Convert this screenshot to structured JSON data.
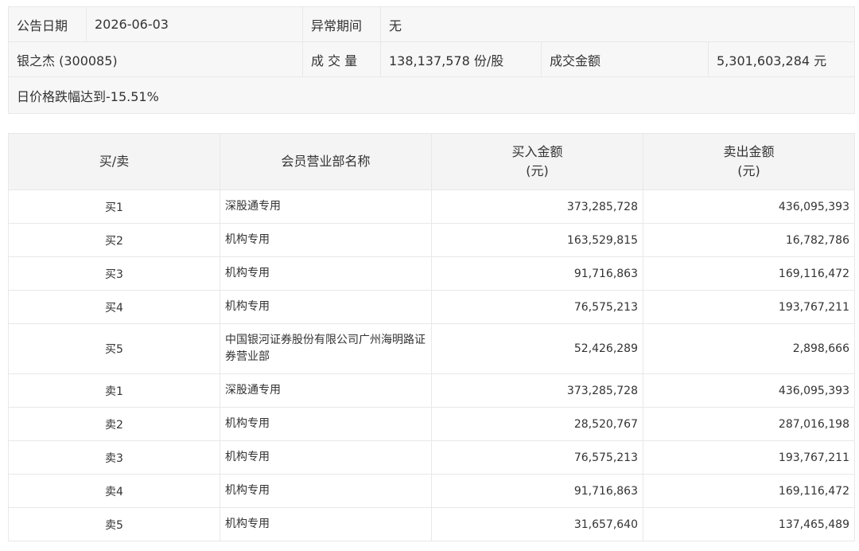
{
  "info": {
    "announce_label": "公告日期",
    "announce_value": "2026-06-03",
    "abnormal_label": "异常期间",
    "abnormal_value": "无",
    "stock_name": "银之杰 (300085)",
    "volume_label": "成 交 量",
    "volume_value": "138,137,578 份/股",
    "amount_label": "成交金额",
    "amount_value": "5,301,603,284 元",
    "reason": "日价格跌幅达到-15.51%"
  },
  "table": {
    "headers": {
      "direction": "买/卖",
      "member": "会员营业部名称",
      "buy_line1": "买入金额",
      "buy_line2": "(元)",
      "sell_line1": "卖出金额",
      "sell_line2": "(元)"
    },
    "rows": [
      {
        "direction": "买1",
        "member": "深股通专用",
        "buy": "373,285,728",
        "sell": "436,095,393"
      },
      {
        "direction": "买2",
        "member": "机构专用",
        "buy": "163,529,815",
        "sell": "16,782,786"
      },
      {
        "direction": "买3",
        "member": "机构专用",
        "buy": "91,716,863",
        "sell": "169,116,472"
      },
      {
        "direction": "买4",
        "member": "机构专用",
        "buy": "76,575,213",
        "sell": "193,767,211"
      },
      {
        "direction": "买5",
        "member": "中国银河证券股份有限公司广州海明路证券营业部",
        "buy": "52,426,289",
        "sell": "2,898,666"
      },
      {
        "direction": "卖1",
        "member": "深股通专用",
        "buy": "373,285,728",
        "sell": "436,095,393"
      },
      {
        "direction": "卖2",
        "member": "机构专用",
        "buy": "28,520,767",
        "sell": "287,016,198"
      },
      {
        "direction": "卖3",
        "member": "机构专用",
        "buy": "76,575,213",
        "sell": "193,767,211"
      },
      {
        "direction": "卖4",
        "member": "机构专用",
        "buy": "91,716,863",
        "sell": "169,116,472"
      },
      {
        "direction": "卖5",
        "member": "机构专用",
        "buy": "31,657,640",
        "sell": "137,465,489"
      }
    ]
  }
}
